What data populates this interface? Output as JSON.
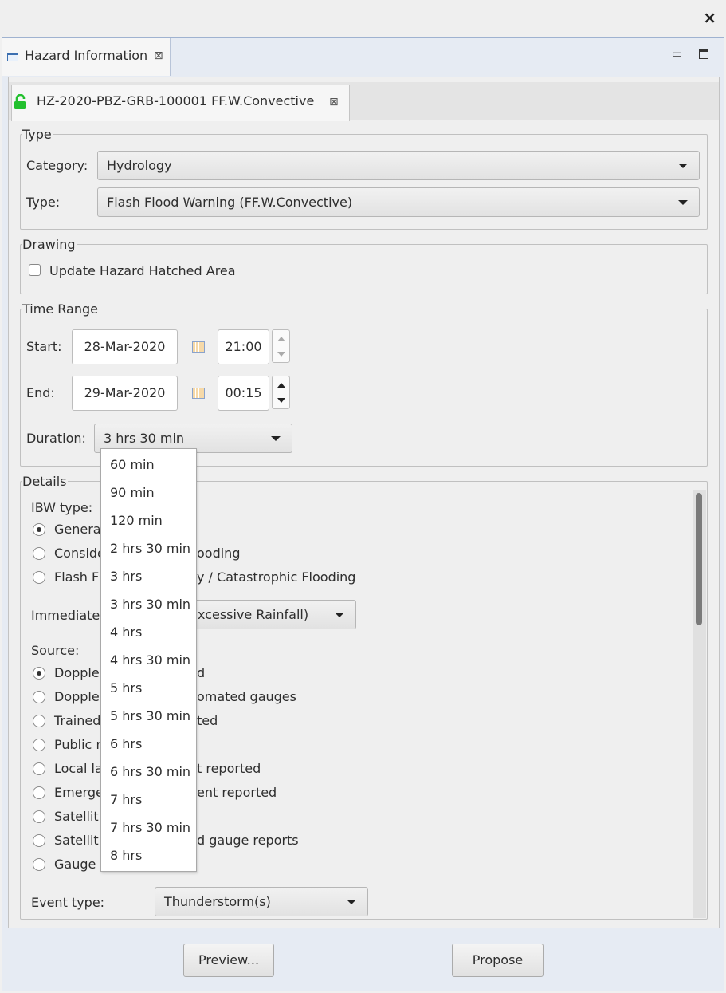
{
  "window": {
    "close_glyph": "×"
  },
  "view_tab": {
    "label": "Hazard Information",
    "close_glyph": "⊠"
  },
  "event_tab": {
    "label": "HZ-2020-PBZ-GRB-100001 FF.W.Convective",
    "close_glyph": "⊠",
    "lock_icon": "unlocked-lock-icon",
    "lock_color": "#22c02e"
  },
  "type_group": {
    "title": "Type",
    "category_label": "Category:",
    "category_value": "Hydrology",
    "type_label": "Type:",
    "type_value": "Flash Flood Warning (FF.W.Convective)"
  },
  "drawing_group": {
    "title": "Drawing",
    "update_hatched_label": "Update Hazard Hatched Area",
    "update_hatched_checked": false
  },
  "time_range": {
    "title": "Time Range",
    "start_label": "Start:",
    "start_date": "28-Mar-2020",
    "start_time": "21:00",
    "end_label": "End:",
    "end_date": "29-Mar-2020",
    "end_time": "00:15",
    "duration_label": "Duration:",
    "duration_value": "3 hrs 30 min"
  },
  "duration_options": [
    "60 min",
    "90 min",
    "120 min",
    "2 hrs 30 min",
    "3 hrs",
    "3 hrs 30 min",
    "4 hrs",
    "4 hrs 30 min",
    "5 hrs",
    "5 hrs 30 min",
    "6 hrs",
    "6 hrs 30 min",
    "7 hrs",
    "7 hrs 30 min",
    "8 hrs"
  ],
  "details": {
    "title": "Details",
    "ibw_label": "IBW type:",
    "ibw_options": [
      {
        "left": "Genera",
        "right": "",
        "selected": true
      },
      {
        "left": "Conside",
        "right": "ooding",
        "selected": false
      },
      {
        "left": "Flash F",
        "right": "y / Catastrophic Flooding",
        "selected": false
      }
    ],
    "immediate_label": "Immediate",
    "immediate_value": "xcessive Rainfall)",
    "source_label": "Source:",
    "source_options": [
      {
        "left": "Dopple",
        "right": "d",
        "selected": true
      },
      {
        "left": "Dopple",
        "right": "omated gauges",
        "selected": false
      },
      {
        "left": "Trained",
        "right": "ted",
        "selected": false
      },
      {
        "left": "Public r",
        "right": "",
        "selected": false
      },
      {
        "left": "Local la",
        "right": "t reported",
        "selected": false
      },
      {
        "left": "Emerge",
        "right": "ent reported",
        "selected": false
      },
      {
        "left": "Satellit",
        "right": "",
        "selected": false
      },
      {
        "left": "Satellit",
        "right": "d gauge reports",
        "selected": false
      },
      {
        "left": "Gauge r",
        "right": "",
        "selected": false
      }
    ],
    "event_type_label": "Event type:",
    "event_type_value": "Thunderstorm(s)"
  },
  "buttons": {
    "preview": "Preview...",
    "propose": "Propose"
  },
  "colors": {
    "accent_blue": "#9fb2d0",
    "lock_green": "#22c02e"
  }
}
